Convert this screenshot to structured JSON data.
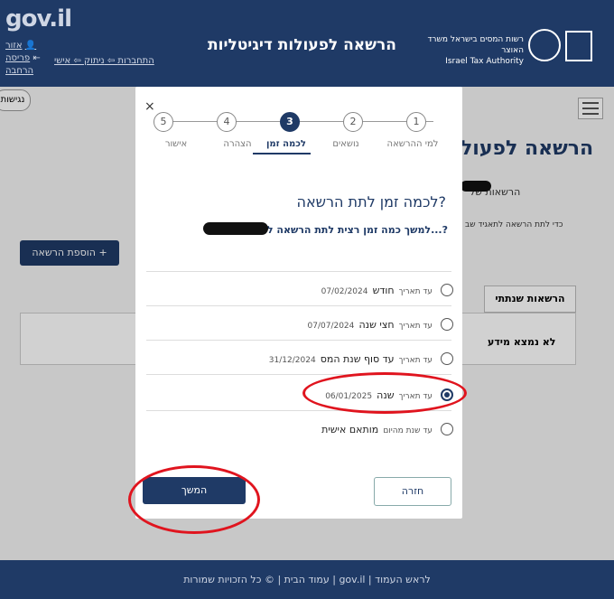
{
  "header": {
    "logo": "gov.il",
    "site_title": "הרשאה לפעולות דיגיטליות",
    "authority_he": "רשות המסים בישראל משרד האוצר",
    "authority_en": "Israel Tax Authority",
    "area": "אזור",
    "personal": "אישי",
    "logout": "ניתוק",
    "connections": "התחברות",
    "print": "פריסה",
    "expand": "הרחבה"
  },
  "lang_button": "נגישות",
  "background": {
    "page_title": "הרשאה לפעול",
    "permissions_of": "הרשאות של",
    "note": "כדי לתת הרשאה לתאגיד שב",
    "add_permission": "הוספת הרשאה  +",
    "tab_my_permissions": "הרשאות שנתתי",
    "no_info": "לא נמצא מידע"
  },
  "modal": {
    "close": "×",
    "steps": [
      {
        "num": "1",
        "label": "למי ההרשאה"
      },
      {
        "num": "2",
        "label": "נושאים"
      },
      {
        "num": "3",
        "label": "לכמה זמן"
      },
      {
        "num": "4",
        "label": "הצהרה"
      },
      {
        "num": "5",
        "label": "אישור"
      }
    ],
    "question": "לכמה זמן לתת הרשאה?",
    "subquestion": "למשך כמה זמן רצית לתת הרשאה לא...?",
    "options": [
      {
        "label": "חודש",
        "date_prefix": "עד תאריך",
        "date": "07/02/2024",
        "selected": false
      },
      {
        "label": "חצי שנה",
        "date_prefix": "עד תאריך",
        "date": "07/07/2024",
        "selected": false
      },
      {
        "label": "עד סוף שנת המס",
        "date_prefix": "עד תאריך",
        "date": "31/12/2024",
        "selected": false
      },
      {
        "label": "שנה",
        "date_prefix": "עד תאריך",
        "date": "06/01/2025",
        "selected": true
      },
      {
        "label": "מותאם אישית",
        "date_prefix": "עד שנת מהיום",
        "date": "",
        "selected": false
      }
    ],
    "next_button": "המשך",
    "back_button": "חזרה"
  },
  "footer": {
    "text": "עמוד הבית  |  © כל הזכויות שמורות  |  gov.il  |  לראש העמוד"
  }
}
